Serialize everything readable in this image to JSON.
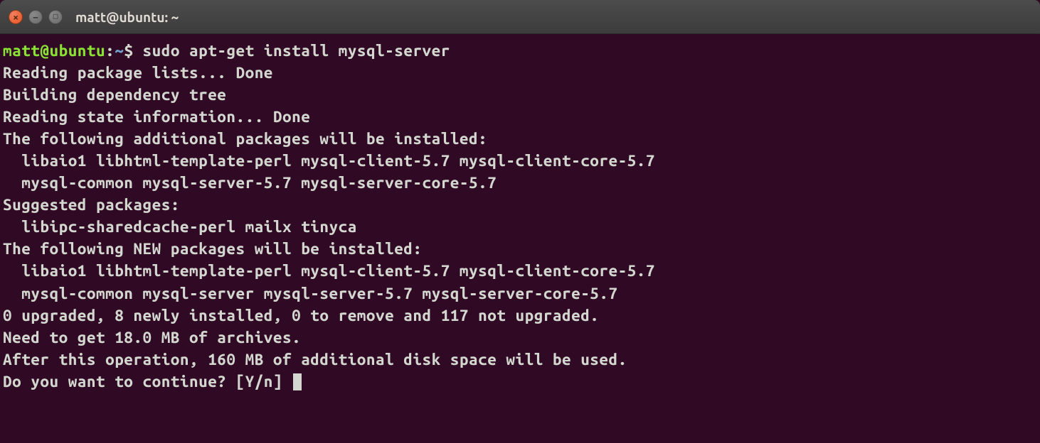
{
  "window": {
    "title": "matt@ubuntu: ~"
  },
  "prompt": {
    "userhost": "matt@ubuntu",
    "colon": ":",
    "path": "~",
    "dollar": "$"
  },
  "command": "sudo apt-get install mysql-server",
  "output": {
    "line1": "Reading package lists... Done",
    "line2": "Building dependency tree",
    "line3": "Reading state information... Done",
    "line4": "The following additional packages will be installed:",
    "line5": "  libaio1 libhtml-template-perl mysql-client-5.7 mysql-client-core-5.7",
    "line6": "  mysql-common mysql-server-5.7 mysql-server-core-5.7",
    "line7": "Suggested packages:",
    "line8": "  libipc-sharedcache-perl mailx tinyca",
    "line9": "The following NEW packages will be installed:",
    "line10": "  libaio1 libhtml-template-perl mysql-client-5.7 mysql-client-core-5.7",
    "line11": "  mysql-common mysql-server mysql-server-5.7 mysql-server-core-5.7",
    "line12": "0 upgraded, 8 newly installed, 0 to remove and 117 not upgraded.",
    "line13": "Need to get 18.0 MB of archives.",
    "line14": "After this operation, 160 MB of additional disk space will be used.",
    "line15": "Do you want to continue? [Y/n] "
  }
}
